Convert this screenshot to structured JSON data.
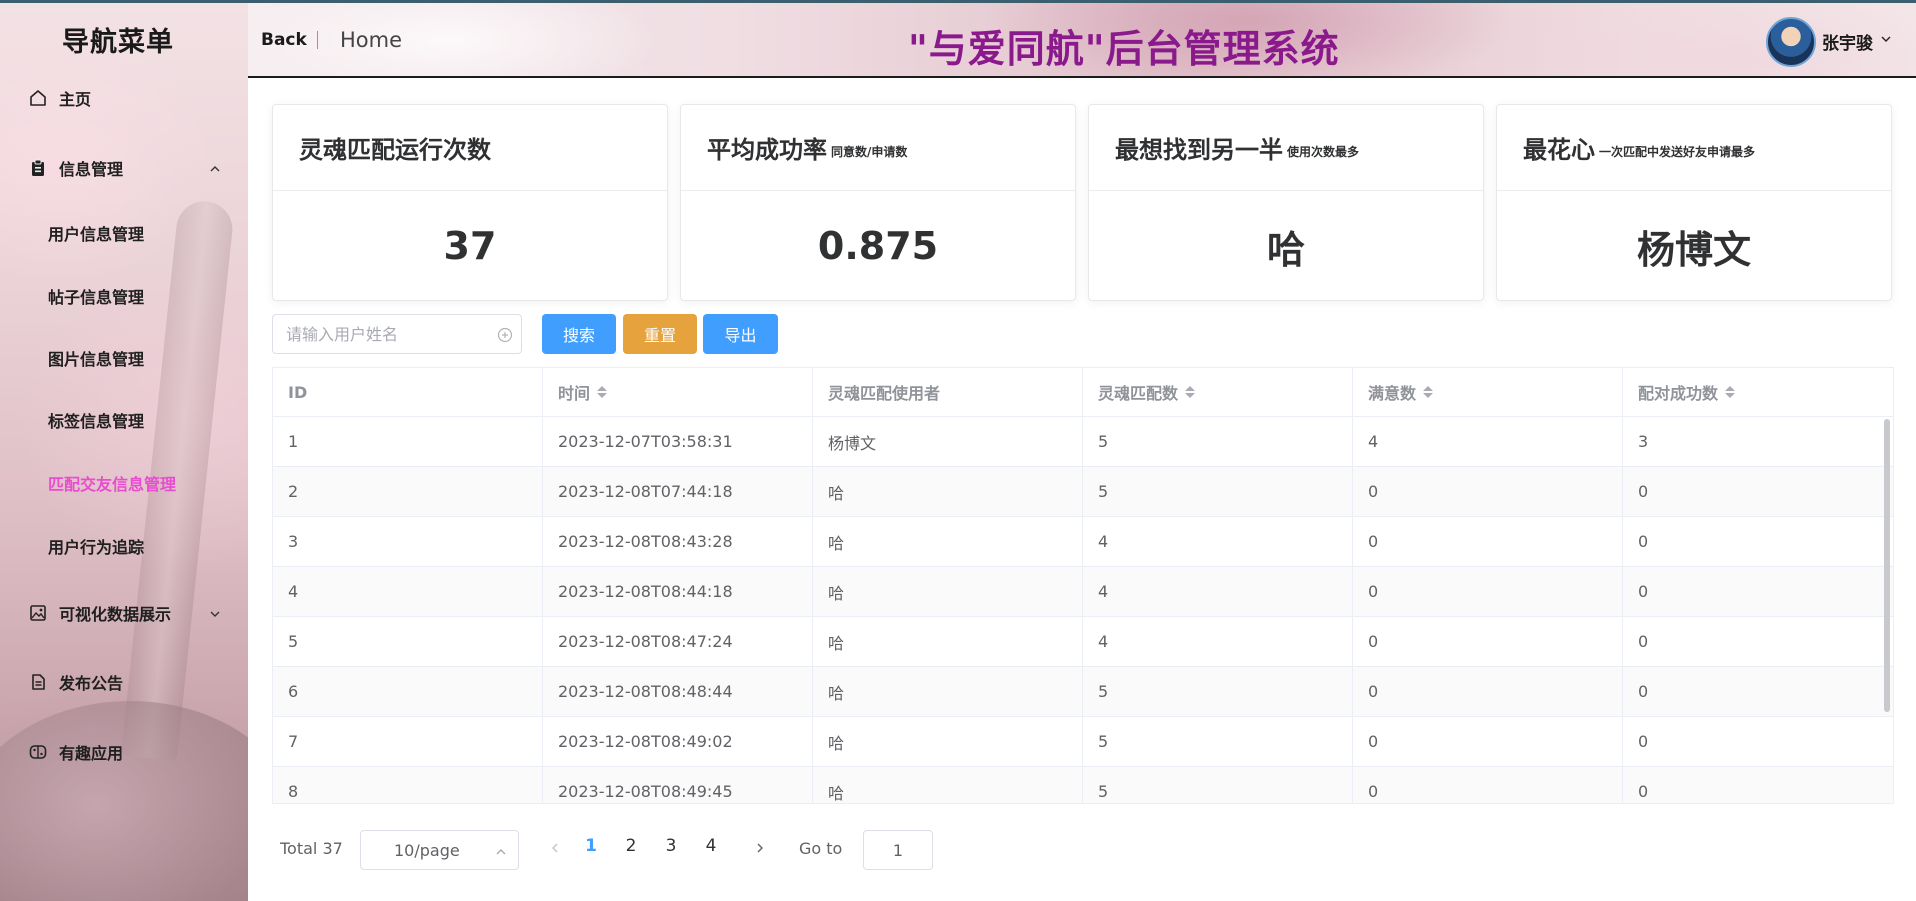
{
  "sidebar": {
    "title": "导航菜单",
    "items": {
      "home": "主页",
      "info_mgmt": "信息管理",
      "sub_user": "用户信息管理",
      "sub_post": "帖子信息管理",
      "sub_image": "图片信息管理",
      "sub_tag": "标签信息管理",
      "sub_match": "匹配交友信息管理",
      "sub_behavior": "用户行为追踪",
      "visual": "可视化数据展示",
      "announce": "发布公告",
      "fun_apps": "有趣应用"
    }
  },
  "header": {
    "back": "Back",
    "home": "Home",
    "app_title": "\"与爱同航\"后台管理系统",
    "username": "张宇骏"
  },
  "cards": [
    {
      "title": "灵魂匹配运行次数",
      "subtitle": "",
      "value": "37"
    },
    {
      "title": "平均成功率",
      "subtitle": "同意数/申请数",
      "value": "0.875"
    },
    {
      "title": "最想找到另一半",
      "subtitle": "使用次数最多",
      "value": "哈"
    },
    {
      "title": "最花心",
      "subtitle": "一次匹配中发送好友申请最多",
      "value": "杨博文"
    }
  ],
  "search": {
    "placeholder": "请输入用户姓名",
    "search_label": "搜索",
    "reset_label": "重置",
    "export_label": "导出"
  },
  "table": {
    "headers": [
      "ID",
      "时间",
      "灵魂匹配使用者",
      "灵魂匹配数",
      "满意数",
      "配对成功数"
    ],
    "rows": [
      [
        "1",
        "2023-12-07T03:58:31",
        "杨博文",
        "5",
        "4",
        "3"
      ],
      [
        "2",
        "2023-12-08T07:44:18",
        "哈",
        "5",
        "0",
        "0"
      ],
      [
        "3",
        "2023-12-08T08:43:28",
        "哈",
        "4",
        "0",
        "0"
      ],
      [
        "4",
        "2023-12-08T08:44:18",
        "哈",
        "4",
        "0",
        "0"
      ],
      [
        "5",
        "2023-12-08T08:47:24",
        "哈",
        "4",
        "0",
        "0"
      ],
      [
        "6",
        "2023-12-08T08:48:44",
        "哈",
        "5",
        "0",
        "0"
      ],
      [
        "7",
        "2023-12-08T08:49:02",
        "哈",
        "5",
        "0",
        "0"
      ],
      [
        "8",
        "2023-12-08T08:49:45",
        "哈",
        "5",
        "0",
        "0"
      ]
    ]
  },
  "pagination": {
    "total": "Total 37",
    "page_size": "10/page",
    "pages": [
      "1",
      "2",
      "3",
      "4"
    ],
    "current_page": "1",
    "goto_label": "Go to",
    "goto_value": "1"
  },
  "colors": {
    "title": "#8a1a8c",
    "active_menu": "#e94cd0",
    "primary": "#409eff",
    "warning": "#e6a23c"
  }
}
